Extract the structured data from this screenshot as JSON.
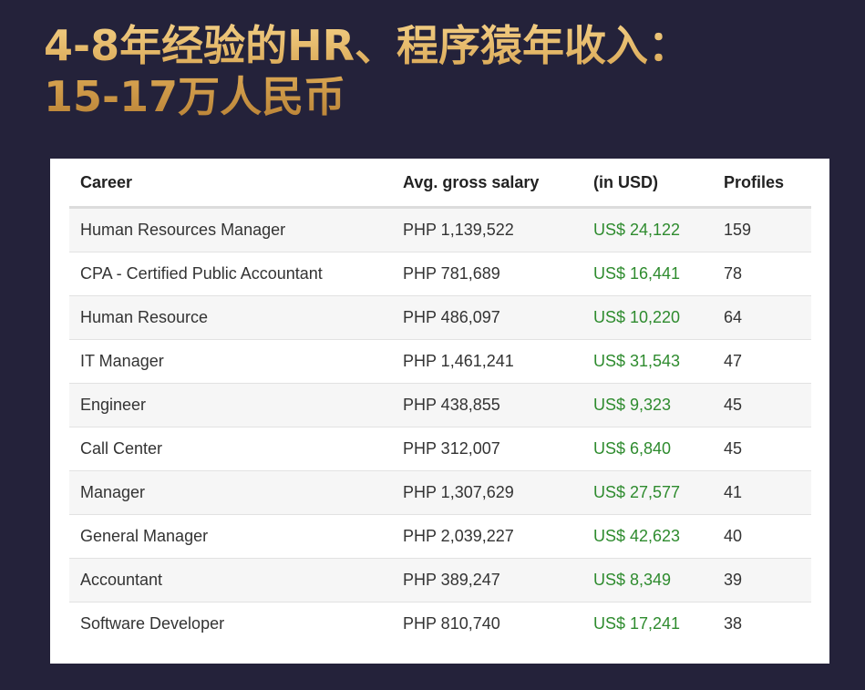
{
  "title": {
    "line1": "4-8年经验的HR、程序猿年收入：",
    "line2": "15-17万人民币"
  },
  "table": {
    "headers": [
      "Career",
      "Avg. gross salary",
      "(in USD)",
      "Profiles"
    ],
    "rows": [
      {
        "career": "Human Resources Manager",
        "salary": "PHP 1,139,522",
        "usd": "US$ 24,122",
        "profiles": "159"
      },
      {
        "career": "CPA - Certified Public Accountant",
        "salary": "PHP 781,689",
        "usd": "US$ 16,441",
        "profiles": "78"
      },
      {
        "career": "Human Resource",
        "salary": "PHP 486,097",
        "usd": "US$ 10,220",
        "profiles": "64"
      },
      {
        "career": "IT Manager",
        "salary": "PHP 1,461,241",
        "usd": "US$ 31,543",
        "profiles": "47"
      },
      {
        "career": "Engineer",
        "salary": "PHP 438,855",
        "usd": "US$ 9,323",
        "profiles": "45"
      },
      {
        "career": "Call Center",
        "salary": "PHP 312,007",
        "usd": "US$ 6,840",
        "profiles": "45"
      },
      {
        "career": "Manager",
        "salary": "PHP 1,307,629",
        "usd": "US$ 27,577",
        "profiles": "41"
      },
      {
        "career": "General Manager",
        "salary": "PHP 2,039,227",
        "usd": "US$ 42,623",
        "profiles": "40"
      },
      {
        "career": "Accountant",
        "salary": "PHP 389,247",
        "usd": "US$ 8,349",
        "profiles": "39"
      },
      {
        "career": "Software Developer",
        "salary": "PHP 810,740",
        "usd": "US$ 17,241",
        "profiles": "38"
      }
    ]
  },
  "colors": {
    "background": "#24223a",
    "title_gold": "#d9a95a",
    "usd_green": "#2e8b2e"
  }
}
